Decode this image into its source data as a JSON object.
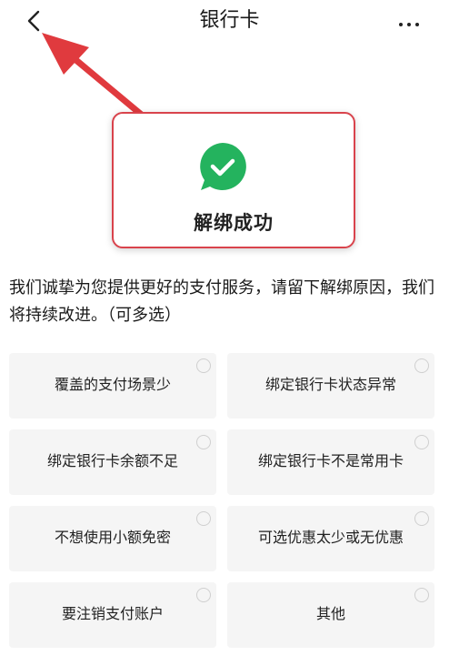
{
  "header": {
    "title": "银行卡",
    "back_icon": "chevron-left-icon",
    "more_icon": "more-dots-icon"
  },
  "success": {
    "icon": "check-circle-icon",
    "text": "解绑成功",
    "icon_color": "#24b35e"
  },
  "description": "我们诚挚为您提供更好的支付服务，请留下解绑原因，我们将持续改进。（可多选）",
  "options": [
    {
      "label": "覆盖的支付场景少",
      "selected": false
    },
    {
      "label": "绑定银行卡状态异常",
      "selected": false
    },
    {
      "label": "绑定银行卡余额不足",
      "selected": false
    },
    {
      "label": "绑定银行卡不是常用卡",
      "selected": false
    },
    {
      "label": "不想使用小额免密",
      "selected": false
    },
    {
      "label": "可选优惠太少或无优惠",
      "selected": false
    },
    {
      "label": "要注销支付账户",
      "selected": false
    },
    {
      "label": "其他",
      "selected": false
    }
  ],
  "colors": {
    "annotation_red": "#d9434c",
    "option_bg": "#f5f5f5"
  }
}
